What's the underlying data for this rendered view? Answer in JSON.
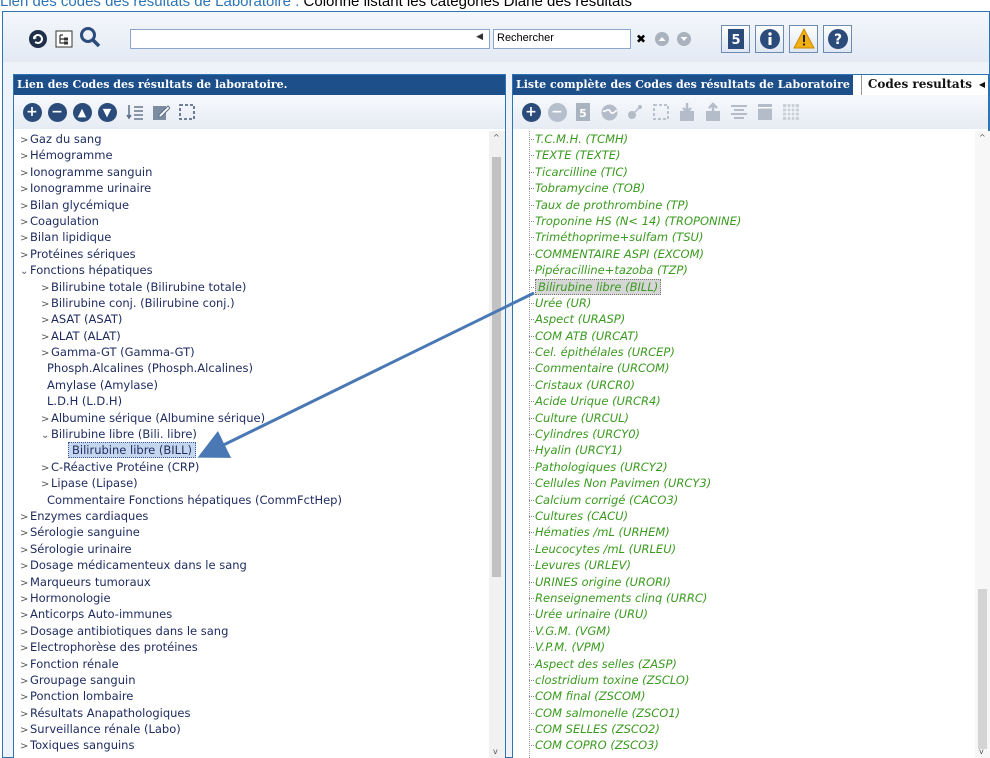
{
  "caption": {
    "link_text": "Lien des codes des résultats de Laboratoire :",
    "rest_text": " Colonne listant les catégories Diane des résultats"
  },
  "toolbar": {
    "search_placeholder": "Rechercher",
    "combo_value": ""
  },
  "left_panel": {
    "title": "Lien des Codes des résultats de laboratoire.",
    "items": [
      {
        "label": "Gaz du sang",
        "level": 0,
        "chev": ">"
      },
      {
        "label": "Hémogramme",
        "level": 0,
        "chev": ">"
      },
      {
        "label": "Ionogramme sanguin",
        "level": 0,
        "chev": ">"
      },
      {
        "label": "Ionogramme urinaire",
        "level": 0,
        "chev": ">"
      },
      {
        "label": "Bilan glycémique",
        "level": 0,
        "chev": ">"
      },
      {
        "label": "Coagulation",
        "level": 0,
        "chev": ">"
      },
      {
        "label": "Bilan lipidique",
        "level": 0,
        "chev": ">"
      },
      {
        "label": "Protéines sériques",
        "level": 0,
        "chev": ">"
      },
      {
        "label": "Fonctions hépatiques",
        "level": 0,
        "chev": "v"
      },
      {
        "label": "Bilirubine totale (Bilirubine totale)",
        "level": 1,
        "chev": ">"
      },
      {
        "label": "Bilirubine conj. (Bilirubine conj.)",
        "level": 1,
        "chev": ">"
      },
      {
        "label": "ASAT (ASAT)",
        "level": 1,
        "chev": ">"
      },
      {
        "label": "ALAT (ALAT)",
        "level": 1,
        "chev": ">"
      },
      {
        "label": "Gamma-GT (Gamma-GT)",
        "level": 1,
        "chev": ">"
      },
      {
        "label": "Phosph.Alcalines (Phosph.Alcalines)",
        "level": 1,
        "chev": ""
      },
      {
        "label": "Amylase (Amylase)",
        "level": 1,
        "chev": ""
      },
      {
        "label": "L.D.H (L.D.H)",
        "level": 1,
        "chev": ""
      },
      {
        "label": "Albumine sérique (Albumine sérique)",
        "level": 1,
        "chev": ">"
      },
      {
        "label": "Bilirubine libre (Bili. libre)",
        "level": 1,
        "chev": "v"
      },
      {
        "label": "Bilirubine libre (BILL)",
        "level": 2,
        "chev": "",
        "selected": true
      },
      {
        "label": "C-Réactive Protéine (CRP)",
        "level": 1,
        "chev": ">"
      },
      {
        "label": "Lipase (Lipase)",
        "level": 1,
        "chev": ">"
      },
      {
        "label": "Commentaire Fonctions hépatiques (CommFctHep)",
        "level": 1,
        "chev": ""
      },
      {
        "label": "Enzymes cardiaques",
        "level": 0,
        "chev": ">"
      },
      {
        "label": "Sérologie sanguine",
        "level": 0,
        "chev": ">"
      },
      {
        "label": "Sérologie urinaire",
        "level": 0,
        "chev": ">"
      },
      {
        "label": "Dosage médicamenteux dans le sang",
        "level": 0,
        "chev": ">"
      },
      {
        "label": "Marqueurs tumoraux",
        "level": 0,
        "chev": ">"
      },
      {
        "label": "Hormonologie",
        "level": 0,
        "chev": ">"
      },
      {
        "label": "Anticorps Auto-immunes",
        "level": 0,
        "chev": ">"
      },
      {
        "label": "Dosage antibiotiques dans le sang",
        "level": 0,
        "chev": ">"
      },
      {
        "label": "Electrophorèse des protéines",
        "level": 0,
        "chev": ">"
      },
      {
        "label": "Fonction rénale",
        "level": 0,
        "chev": ">"
      },
      {
        "label": "Groupage sanguin",
        "level": 0,
        "chev": ">"
      },
      {
        "label": "Ponction lombaire",
        "level": 0,
        "chev": ">"
      },
      {
        "label": "Résultats Anapathologiques",
        "level": 0,
        "chev": ">"
      },
      {
        "label": "Surveillance rénale (Labo)",
        "level": 0,
        "chev": ">"
      },
      {
        "label": "Toxiques sanguins",
        "level": 0,
        "chev": ">"
      }
    ]
  },
  "right_panel": {
    "title": "Liste complète des Codes des résultats de Laboratoire",
    "tab_label": "Codes resultats",
    "items": [
      "T.C.M.H. (TCMH)",
      "TEXTE (TEXTE)",
      "Ticarcilline (TIC)",
      "Tobramycine (TOB)",
      "Taux de prothrombine (TP)",
      "Troponine HS (N< 14) (TROPONINE)",
      "Triméthoprime+sulfam (TSU)",
      "COMMENTAIRE ASPI (EXCOM)",
      "Pipéracilline+tazoba (TZP)",
      "Bilirubine libre (BILL)",
      "Urée (UR)",
      "Aspect (URASP)",
      "COM ATB (URCAT)",
      "Cel. épithélales (URCEP)",
      "Commentaire (URCOM)",
      "Cristaux (URCR0)",
      "Acide Urique (URCR4)",
      "Culture (URCUL)",
      "Cylindres (URCY0)",
      "Hyalin (URCY1)",
      "Pathologiques (URCY2)",
      "Cellules Non Pavimen (URCY3)",
      "Calcium corrigé (CACO3)",
      "Cultures (CACU)",
      "Hématies /mL (URHEM)",
      "Leucocytes /mL (URLEU)",
      "Levures (URLEV)",
      "URINES origine (URORI)",
      "Renseignements clinq (URRC)",
      "Urée urinaire (URU)",
      "V.G.M. (VGM)",
      "V.P.M. (VPM)",
      "Aspect des selles (ZASP)",
      "clostridium toxine (ZSCLO)",
      "COM final (ZSCOM)",
      "COM salmonelle (ZSCO1)",
      "COM SELLES (ZSCO2)",
      "COM COPRO (ZSCO3)"
    ],
    "selected_index": 9
  },
  "colors": {
    "header_bg": "#1d4f8a",
    "tree_text": "#1d2a5e",
    "list_text": "#3a9a1f",
    "arrow": "#4a78b5"
  }
}
